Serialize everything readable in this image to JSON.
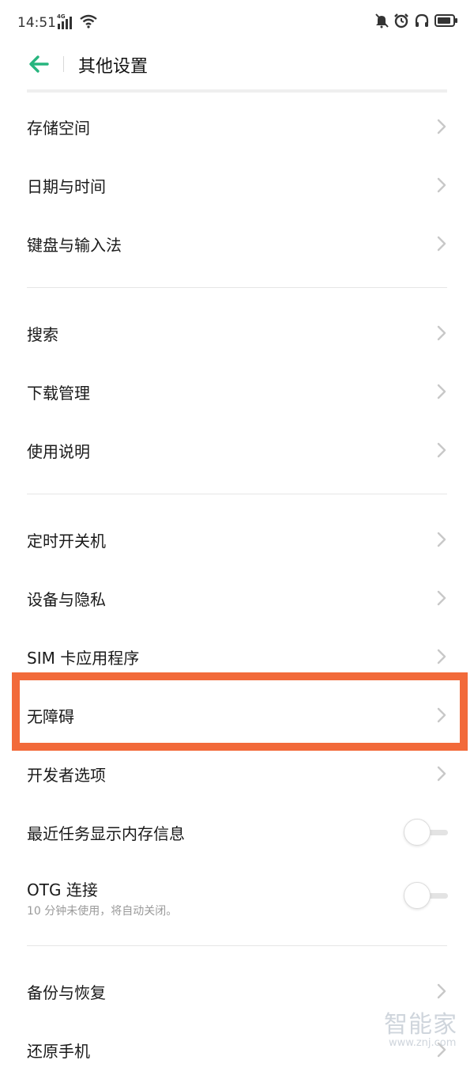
{
  "status_bar": {
    "time": "14:51",
    "network": "4G",
    "icons_left": [
      "signal-icon",
      "wifi-icon"
    ],
    "icons_right": [
      "mute-icon",
      "alarm-icon",
      "headset-icon",
      "battery-icon"
    ]
  },
  "header": {
    "title": "其他设置",
    "back_icon": "arrow-left-icon",
    "accent_color": "#27b57e"
  },
  "groups": [
    {
      "items": [
        {
          "label": "存储空间",
          "type": "nav"
        },
        {
          "label": "日期与时间",
          "type": "nav"
        },
        {
          "label": "键盘与输入法",
          "type": "nav"
        }
      ]
    },
    {
      "items": [
        {
          "label": "搜索",
          "type": "nav"
        },
        {
          "label": "下载管理",
          "type": "nav"
        },
        {
          "label": "使用说明",
          "type": "nav"
        }
      ]
    },
    {
      "items": [
        {
          "label": "定时开关机",
          "type": "nav"
        },
        {
          "label": "设备与隐私",
          "type": "nav"
        },
        {
          "label": "SIM 卡应用程序",
          "type": "nav"
        },
        {
          "label": "无障碍",
          "type": "nav",
          "highlighted": true
        },
        {
          "label": "开发者选项",
          "type": "nav"
        },
        {
          "label": "最近任务显示内存信息",
          "type": "toggle",
          "value": false
        },
        {
          "label": "OTG 连接",
          "sublabel": "10 分钟未使用，将自动关闭。",
          "type": "toggle",
          "value": false
        }
      ]
    },
    {
      "items": [
        {
          "label": "备份与恢复",
          "type": "nav"
        },
        {
          "label": "还原手机",
          "type": "nav"
        }
      ]
    }
  ],
  "highlight_color": "#f26a3a",
  "watermark": {
    "title": "智能家",
    "url": "www.znj.com"
  }
}
